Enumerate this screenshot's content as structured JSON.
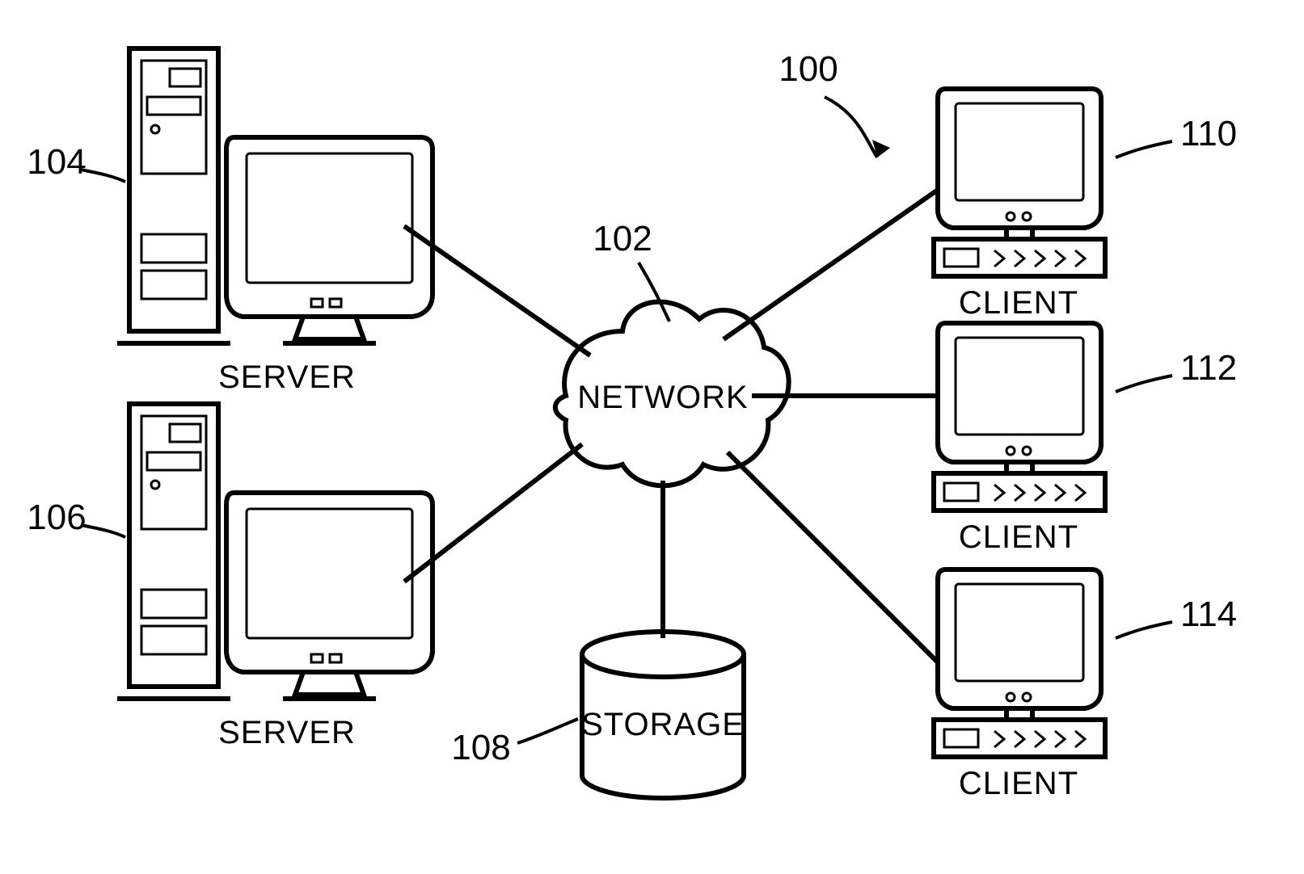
{
  "diagram": {
    "ref_system": "100",
    "network": {
      "label": "NETWORK",
      "ref": "102"
    },
    "storage": {
      "label": "STORAGE",
      "ref": "108"
    },
    "servers": [
      {
        "label": "SERVER",
        "ref": "104"
      },
      {
        "label": "SERVER",
        "ref": "106"
      }
    ],
    "clients": [
      {
        "label": "CLIENT",
        "ref": "110"
      },
      {
        "label": "CLIENT",
        "ref": "112"
      },
      {
        "label": "CLIENT",
        "ref": "114"
      }
    ]
  }
}
